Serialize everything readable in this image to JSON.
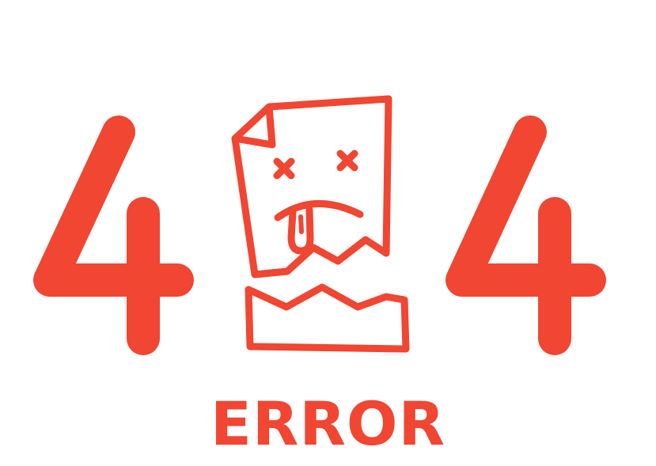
{
  "illustration": {
    "digit_left": "4",
    "digit_right": "4",
    "label": "ERROR"
  },
  "colors": {
    "accent": "#f04632",
    "background": "#ffffff"
  },
  "icons": {
    "center": "torn-paper-dead-face-icon"
  }
}
